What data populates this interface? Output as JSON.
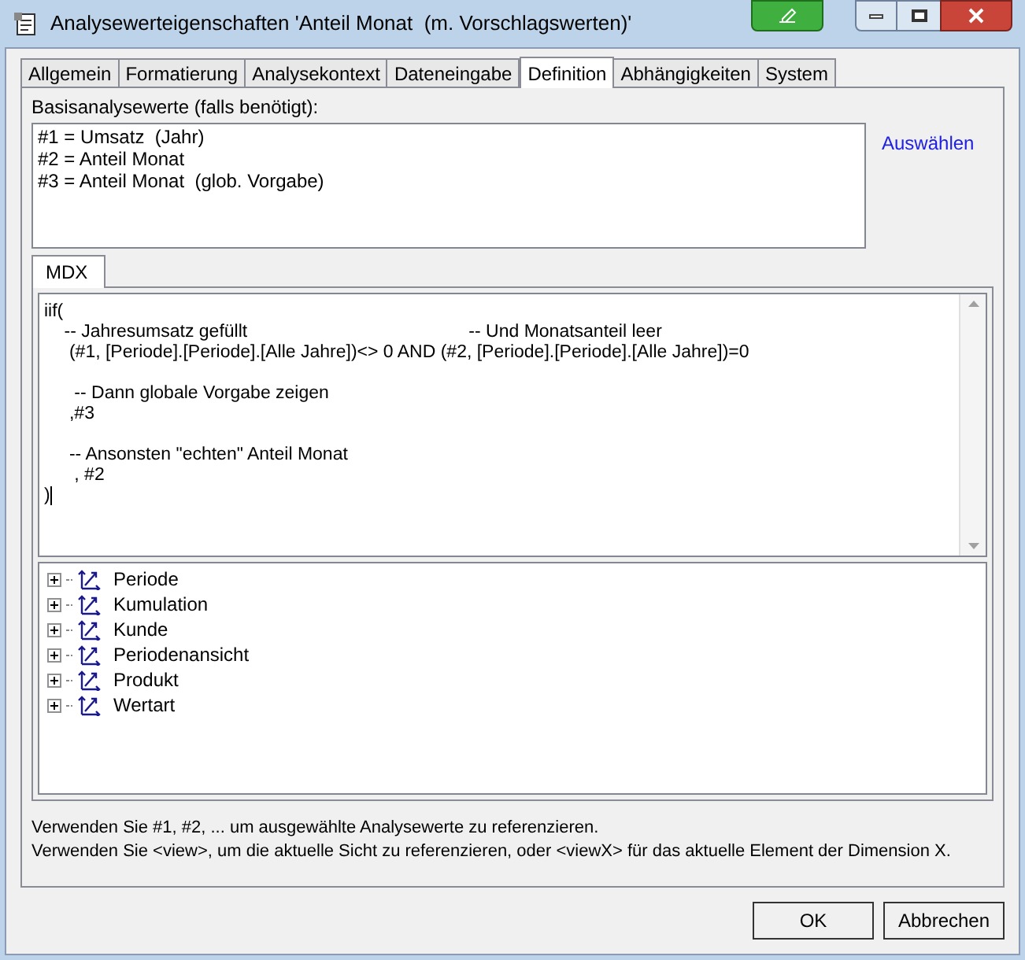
{
  "window": {
    "title": "Analysewerteigenschaften 'Anteil Monat  (m. Vorschlagswerten)'"
  },
  "tabs": [
    {
      "label": "Allgemein",
      "selected": false
    },
    {
      "label": "Formatierung",
      "selected": false
    },
    {
      "label": "Analysekontext",
      "selected": false
    },
    {
      "label": "Dateneingabe",
      "selected": false
    },
    {
      "label": "Definition",
      "selected": true
    },
    {
      "label": "Abhängigkeiten",
      "selected": false
    },
    {
      "label": "System",
      "selected": false
    }
  ],
  "base_values": {
    "label": "Basisanalysewerte (falls benötigt):",
    "items": [
      "#1 = Umsatz  (Jahr)",
      "#2 = Anteil Monat",
      "#3 = Anteil Monat  (glob. Vorgabe)"
    ],
    "link": "Auswählen"
  },
  "editor_tabs": [
    {
      "label": "MDX",
      "selected": true
    }
  ],
  "mdx": {
    "value": "iif(\n    -- Jahresumsatz gefüllt                                            -- Und Monatsanteil leer\n     (#1, [Periode].[Periode].[Alle Jahre])<> 0 AND (#2, [Periode].[Periode].[Alle Jahre])=0\n\n      -- Dann globale Vorgabe zeigen\n     ,#3\n\n     -- Ansonsten \"echten\" Anteil Monat\n      , #2\n)"
  },
  "tree": [
    {
      "label": "Periode",
      "expanded": false
    },
    {
      "label": "Kumulation",
      "expanded": false
    },
    {
      "label": "Kunde",
      "expanded": false
    },
    {
      "label": "Periodenansicht",
      "expanded": false
    },
    {
      "label": "Produkt",
      "expanded": false
    },
    {
      "label": "Wertart",
      "expanded": false
    }
  ],
  "hints": [
    "Verwenden Sie #1, #2, ... um ausgewählte Analysewerte zu referenzieren.",
    "Verwenden Sie <view>, um die aktuelle Sicht zu referenzieren, oder <viewX> für das aktuelle Element der Dimension X."
  ],
  "buttons": [
    "OK",
    "Abbrechen"
  ]
}
